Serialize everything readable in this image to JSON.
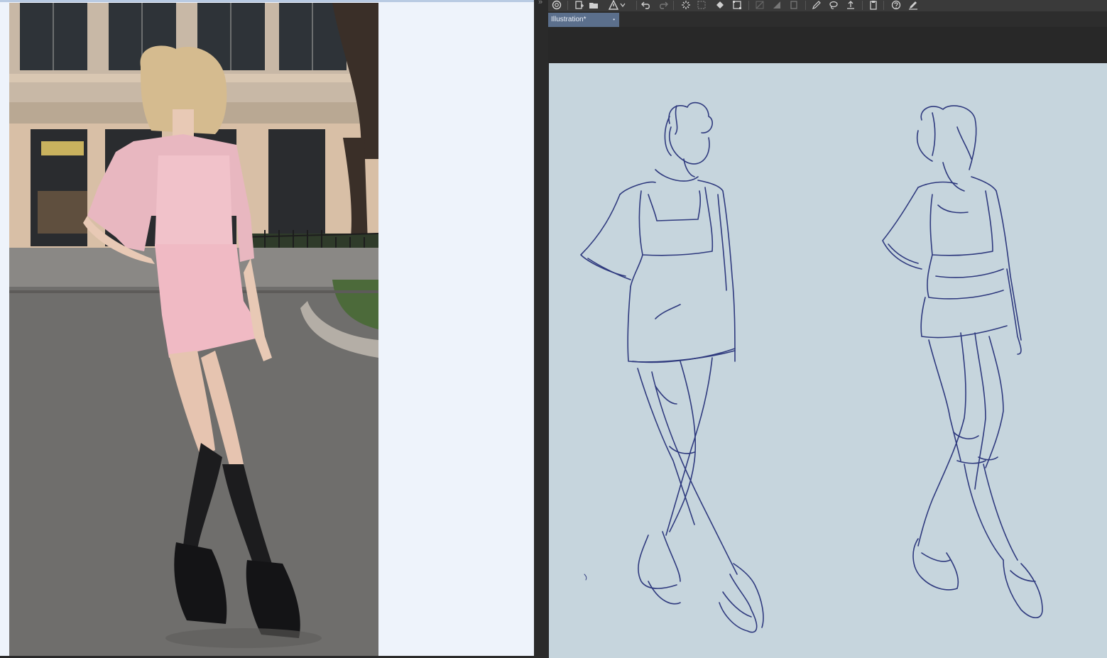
{
  "app": {
    "tab_title": "Illustration*",
    "tab_close_glyph": "•",
    "toolbar_icons": [
      "cloud-sync-icon",
      "new-file-icon",
      "open-file-icon",
      "warning-icon",
      "dropdown-arrow-icon",
      "undo-icon",
      "redo-icon",
      "loading-icon",
      "select-icon",
      "fill-icon",
      "transform-icon",
      "ruler-icon",
      "gradient-icon",
      "frame-icon",
      "edit-icon",
      "lasso-icon",
      "export-icon",
      "clipboard-icon",
      "help-icon",
      "pen-icon"
    ]
  },
  "colors": {
    "canvas": "#c6d5dd",
    "sketch_stroke": "#2f3a7e",
    "tab_active": "#5b6f8c",
    "viewer_bg": "#eef3fb"
  },
  "viewer": {
    "photo_subject": "reference photo of woman in pink knit dress and cardigan"
  }
}
